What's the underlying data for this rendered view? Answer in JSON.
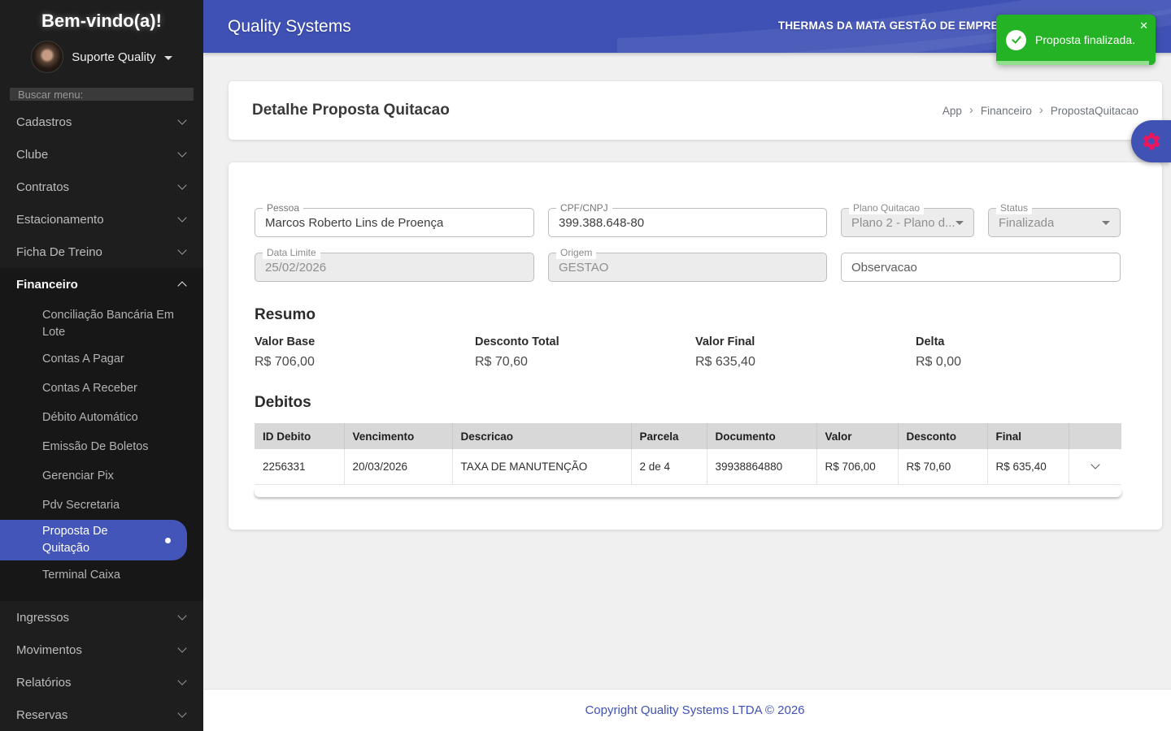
{
  "colors": {
    "header_indigo": "#3f51b5",
    "sidebar_bg": "#1e1e1e",
    "selected_pill": "#4355b8",
    "toast_green": "#24b324",
    "toast_progress": "#90e090",
    "gear_pink": "#ec155e",
    "content_bg": "#f0f0f1",
    "disabled_field_bg": "#ececec",
    "table_header_bg": "#d8d8d8",
    "footer_link": "#3f51b5"
  },
  "sidebar": {
    "welcome_title": "Bem-vindo(a)!",
    "user_name": "Suporte Quality",
    "search_placeholder": "Buscar menu:",
    "menu_top": [
      {
        "label": "Cadastros"
      },
      {
        "label": "Clube"
      },
      {
        "label": "Contratos"
      },
      {
        "label": "Estacionamento"
      },
      {
        "label": "Ficha De Treino"
      }
    ],
    "financeiro": {
      "label": "Financeiro"
    },
    "financeiro_submenu": [
      "Conciliação Bancária Em Lote",
      "Contas A Pagar",
      "Contas A Receber",
      "Débito Automático",
      "Emissão De Boletos",
      "Gerenciar Pix",
      "Pdv Secretaria",
      "Proposta De Quitação",
      "Terminal Caixa"
    ],
    "selected_item": "Proposta De Quitação",
    "menu_bottom": [
      {
        "label": "Ingressos"
      },
      {
        "label": "Movimentos"
      },
      {
        "label": "Relatórios"
      },
      {
        "label": "Reservas"
      }
    ]
  },
  "header": {
    "app_title": "Quality Systems",
    "company_name": "THERMAS DA MATA GESTÃO DE EMPREEN"
  },
  "toast": {
    "message": "Proposta finalizada.",
    "close_icon": "✕"
  },
  "page": {
    "title": "Detalhe Proposta Quitacao",
    "breadcrumb": [
      "App",
      "Financeiro",
      "PropostaQuitacao"
    ],
    "breadcrumb_separator": "›"
  },
  "form": {
    "pessoa": {
      "label": "Pessoa",
      "value": "Marcos Roberto Lins de Proença"
    },
    "cpf": {
      "label": "CPF/CNPJ",
      "value": "399.388.648-80"
    },
    "plano": {
      "label": "Plano Quitacao",
      "value": "Plano 2 - Plano d..."
    },
    "status": {
      "label": "Status",
      "value": "Finalizada"
    },
    "data_limite": {
      "label": "Data Limite",
      "value": "25/02/2026"
    },
    "origem": {
      "label": "Origem",
      "value": "GESTAO"
    },
    "observacao": {
      "placeholder": "Observacao",
      "value": ""
    }
  },
  "resumo": {
    "title": "Resumo",
    "items": [
      {
        "label": "Valor Base",
        "value": "R$ 706,00"
      },
      {
        "label": "Desconto Total",
        "value": "R$ 70,60"
      },
      {
        "label": "Valor Final",
        "value": "R$ 635,40"
      },
      {
        "label": "Delta",
        "value": "R$ 0,00"
      }
    ]
  },
  "debitos": {
    "title": "Debitos",
    "columns": [
      "ID Debito",
      "Vencimento",
      "Descricao",
      "Parcela",
      "Documento",
      "Valor",
      "Desconto",
      "Final"
    ],
    "rows": [
      [
        "2256331",
        "20/03/2026",
        "TAXA DE MANUTENÇÃO",
        "2 de 4",
        "39938864880",
        "R$ 706,00",
        "R$ 70,60",
        "R$ 635,40"
      ]
    ]
  },
  "footer": {
    "copyright": "Copyright Quality Systems LTDA © 2026"
  }
}
